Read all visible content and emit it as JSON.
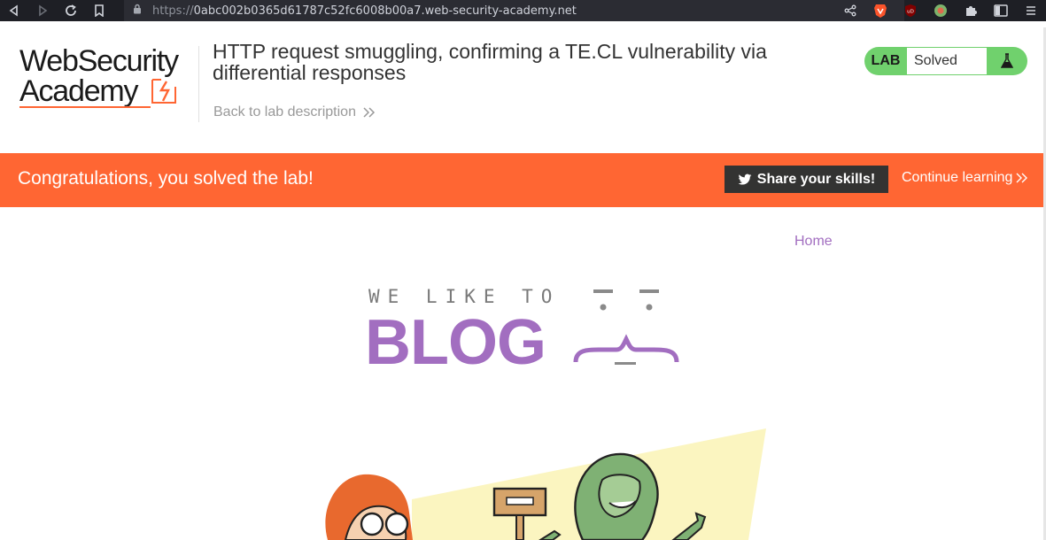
{
  "browser": {
    "url_protocol": "https://",
    "url_host": "0abc002b0365d61787c52fc6008b00a7.web-security-academy.net"
  },
  "header": {
    "logo_line1": "WebSecurity",
    "logo_line2": "Academy",
    "lab_title": "HTTP request smuggling, confirming a TE.CL vulnerability via differential responses",
    "back_link": "Back to lab description",
    "lab_badge": "LAB",
    "lab_status": "Solved"
  },
  "banner": {
    "message": "Congratulations, you solved the lab!",
    "share_button": "Share your skills!",
    "continue_link": "Continue learning"
  },
  "blog": {
    "nav_home": "Home",
    "logo_tagline": "WE LIKE TO",
    "logo_word": "BLOG"
  },
  "colors": {
    "accent_orange": "#ff6633",
    "lab_green": "#70d16d",
    "blog_purple": "#a26ec0",
    "dark_button": "#333332"
  },
  "icons": {
    "back": "back-arrow-icon",
    "forward": "forward-arrow-icon",
    "reload": "reload-icon",
    "bookmark": "bookmark-icon",
    "lock": "lock-icon",
    "share": "share-icon",
    "brave": "brave-lion-icon",
    "ublock": "ublock-icon",
    "extensions": "puzzle-icon",
    "sidebar": "sidebar-icon",
    "menu": "menu-icon",
    "twitter": "twitter-icon",
    "flask": "flask-icon"
  }
}
